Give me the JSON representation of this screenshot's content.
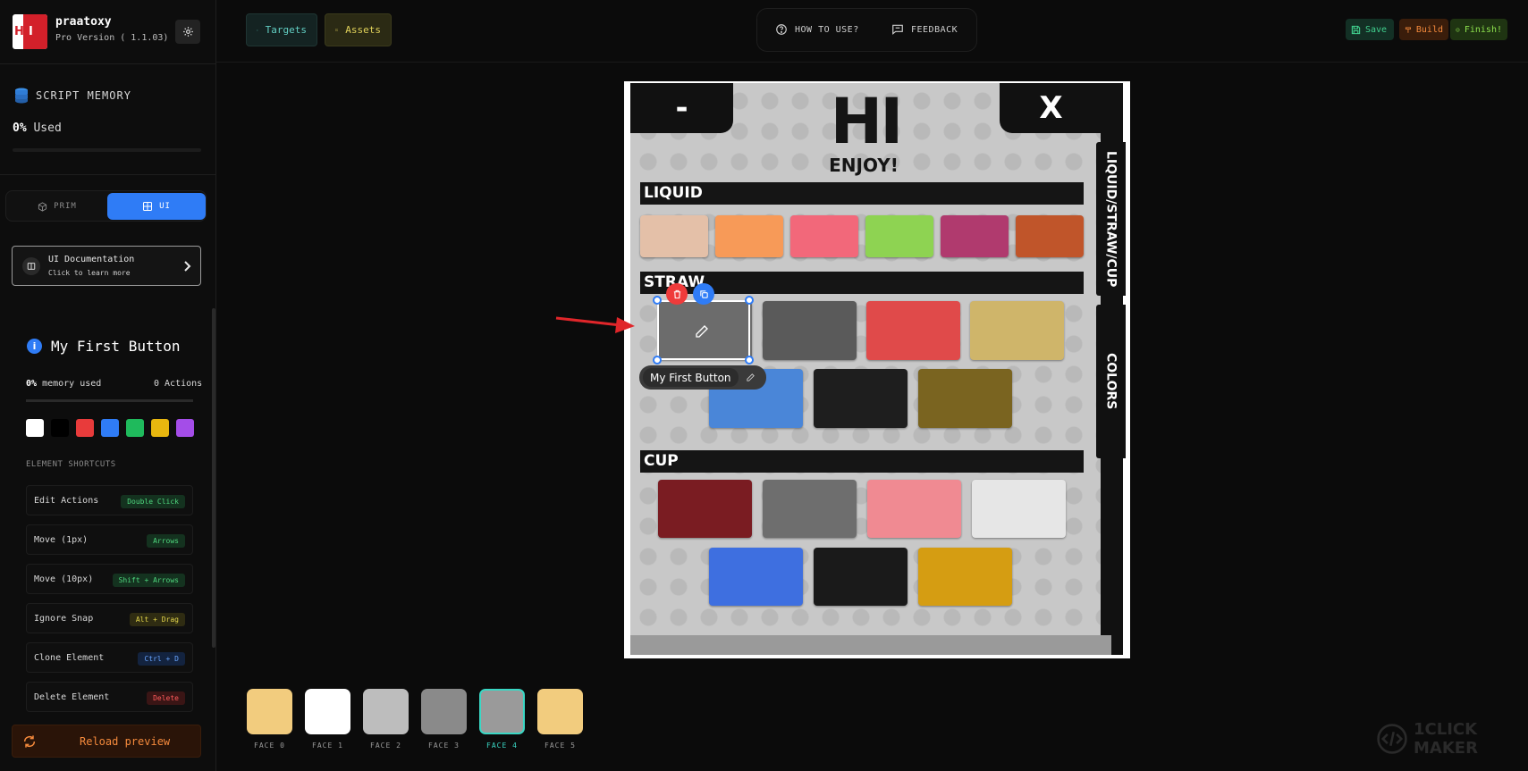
{
  "brand": {
    "name": "praatoxy",
    "version": "Pro Version ( 1.1.03)"
  },
  "memory": {
    "title": "SCRIPT MEMORY",
    "percent": "0%",
    "used_label": " Used"
  },
  "modes": {
    "prim": "PRIM",
    "ui": "UI",
    "active": "ui"
  },
  "docs": {
    "title": "UI Documentation",
    "subtitle": "Click to learn more"
  },
  "element": {
    "name": "My First Button",
    "memory_percent": "0%",
    "memory_label": " memory used",
    "actions": "0 Actions",
    "swatches": [
      "#ffffff",
      "#000000",
      "#e83b3b",
      "#2f7cf6",
      "#1fba5c",
      "#e8b70f",
      "#a44de8"
    ]
  },
  "shortcuts": {
    "heading": "ELEMENT SHORTCUTS",
    "items": [
      {
        "label": "Edit Actions",
        "key": "Double Click",
        "style": "green"
      },
      {
        "label": "Move (1px)",
        "key": "Arrows",
        "style": "green"
      },
      {
        "label": "Move (10px)",
        "key": "Shift + Arrows",
        "style": "green"
      },
      {
        "label": "Ignore Snap",
        "key": "Alt + Drag",
        "style": "yellow"
      },
      {
        "label": "Clone Element",
        "key": "Ctrl + D",
        "style": "blue"
      },
      {
        "label": "Delete Element",
        "key": "Delete",
        "style": "red"
      }
    ]
  },
  "reload": "Reload preview",
  "toolbar": {
    "targets": "Targets",
    "assets": "Assets",
    "how_to": "HOW TO USE?",
    "feedback": "FEEDBACK",
    "save": "Save",
    "build": "Build",
    "finish": "Finish!"
  },
  "canvas": {
    "minimize": "-",
    "close": "X",
    "headline": "HI",
    "tagline": "ENJOY!",
    "side_tab_1": "LIQUID/STRAW/CUP",
    "side_tab_2": "COLORS",
    "sections": {
      "liquid": "LIQUID",
      "straw": "STRAW",
      "cup": "CUP"
    },
    "liquid_colors": [
      "#e4c0a8",
      "#f79a58",
      "#f2687a",
      "#8ed352",
      "#b03a6e",
      "#c0552a"
    ],
    "straw_row1": [
      "#5a5a5a",
      "#e04a4a",
      "#cfb56a"
    ],
    "straw_row2": [
      "#4a86d8",
      "#1e1e1e",
      "#7a6420"
    ],
    "cup_row1": [
      "#7a1c22",
      "#6e6e6e",
      "#f08a92",
      "#e6e6e6"
    ],
    "cup_row2": [
      "#3e6fe0",
      "#1a1a1a",
      "#d59d12"
    ],
    "selected": {
      "name": "My First Button"
    }
  },
  "faces": {
    "items": [
      {
        "label": "FACE 0",
        "color": "#f2cc7e"
      },
      {
        "label": "FACE 1",
        "color": "#ffffff"
      },
      {
        "label": "FACE 2",
        "color": "#bdbdbd"
      },
      {
        "label": "FACE 3",
        "color": "#8a8a8a"
      },
      {
        "label": "FACE 4",
        "color": "#9a9a9a"
      },
      {
        "label": "FACE 5",
        "color": "#f2cc7e"
      }
    ],
    "active": 4
  },
  "watermark": "1CLICK MAKER"
}
